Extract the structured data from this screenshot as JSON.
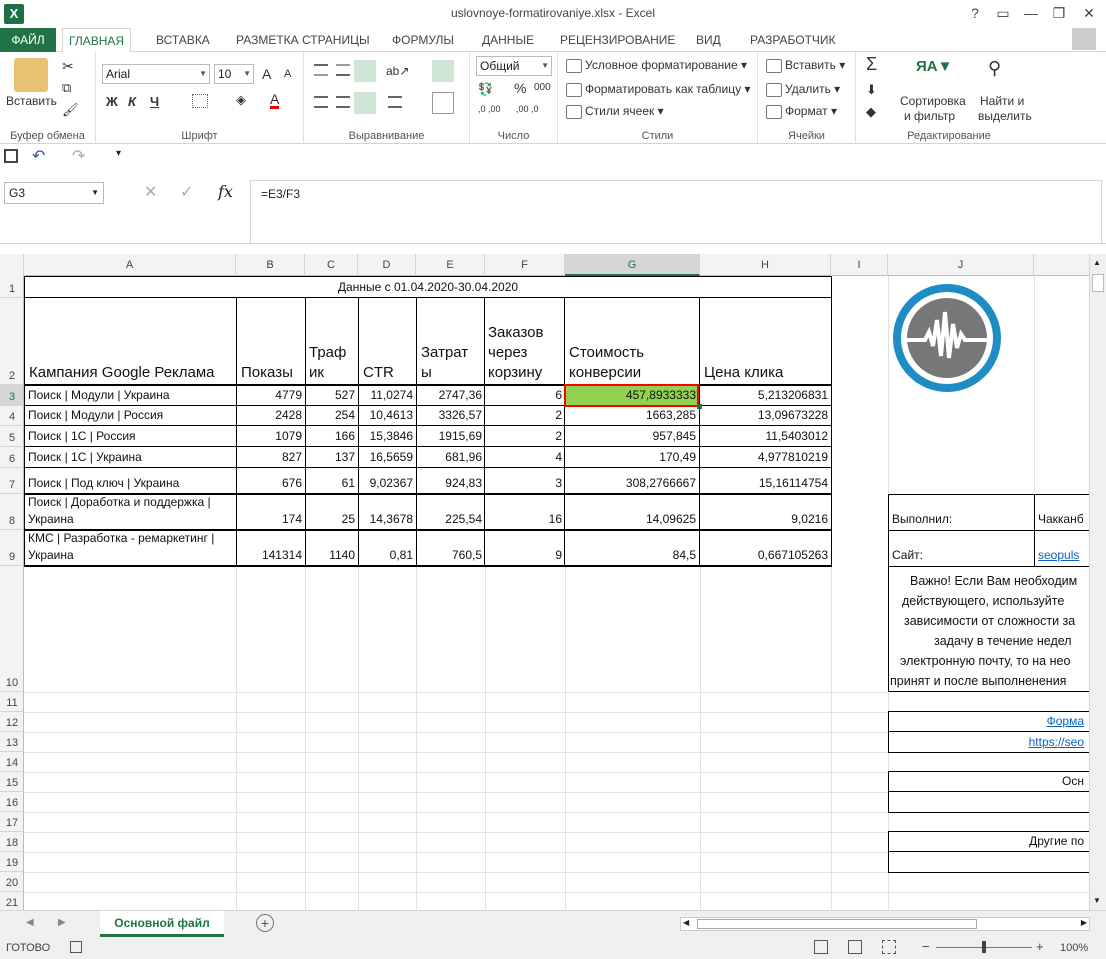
{
  "window": {
    "title": "uslovnoye-formatirovaniye.xlsx - Excel",
    "help": "?",
    "minimize": "—",
    "restore": "❐",
    "close": "✕",
    "user_name": "",
    "app_icon": "X"
  },
  "tabs": [
    "ФАЙЛ",
    "ГЛАВНАЯ",
    "ВСТАВКА",
    "РАЗМЕТКА СТРАНИЦЫ",
    "ФОРМУЛЫ",
    "ДАННЫЕ",
    "РЕЦЕНЗИРОВАНИЕ",
    "ВИД",
    "РАЗРАБОТЧИК"
  ],
  "ribbon": {
    "clipboard": {
      "paste": "Вставить",
      "label": "Буфер обмена"
    },
    "font": {
      "name": "Arial",
      "size": "10",
      "bold": "Ж",
      "italic": "К",
      "underline": "Ч",
      "grow": "A",
      "shrink": "A",
      "color_letter": "A",
      "label": "Шрифт"
    },
    "alignment": {
      "label": "Выравнивание"
    },
    "number": {
      "format": "Общий",
      "percent": "%",
      "comma": "000",
      "inc": ",0 ,00",
      "dec": ",00 ,0",
      "label": "Число"
    },
    "styles": {
      "cond": "Условное форматирование",
      "table": "Форматировать как таблицу",
      "cell": "Стили ячеек",
      "label": "Стили"
    },
    "cells": {
      "insert": "Вставить",
      "delete": "Удалить",
      "format": "Формат",
      "label": "Ячейки"
    },
    "editing": {
      "sort1": "Сортировка",
      "sort2": "и фильтр",
      "find1": "Найти и",
      "find2": "выделить",
      "label": "Редактирование"
    }
  },
  "formula_bar": {
    "name_box": "G3",
    "cancel": "✕",
    "enter": "✓",
    "fx": "fx",
    "formula": "=E3/F3"
  },
  "columns": [
    "A",
    "B",
    "C",
    "D",
    "E",
    "F",
    "G",
    "H",
    "I",
    "J"
  ],
  "rows": [
    "1",
    "2",
    "3",
    "4",
    "5",
    "6",
    "7",
    "8",
    "9",
    "10",
    "11",
    "12",
    "13",
    "14",
    "15",
    "16",
    "17",
    "18",
    "19",
    "20",
    "21"
  ],
  "sheet": {
    "header_row1": "Данные с 01.04.2020-30.04.2020",
    "headers": {
      "A": "Кампания Google Реклама",
      "B": "Показы",
      "C1": "Траф",
      "C2": "ик",
      "D": "CTR",
      "E1": "Затрат",
      "E2": "ы",
      "F1": "Заказов",
      "F2": "через",
      "F3": "корзину",
      "G1": "Стоимость",
      "G2": "конверсии",
      "H": "Цена клика"
    },
    "data": [
      {
        "A": "Поиск | Модули | Украина",
        "B": "4779",
        "C": "527",
        "D": "11,0274",
        "E": "2747,36",
        "F": "6",
        "G": "457,8933333",
        "H": "5,213206831"
      },
      {
        "A": "Поиск | Модули | Россия",
        "B": "2428",
        "C": "254",
        "D": "10,4613",
        "E": "3326,57",
        "F": "2",
        "G": "1663,285",
        "H": "13,09673228"
      },
      {
        "A": "Поиск | 1С | Россия",
        "B": "1079",
        "C": "166",
        "D": "15,3846",
        "E": "1915,69",
        "F": "2",
        "G": "957,845",
        "H": "11,5403012"
      },
      {
        "A": "Поиск | 1С | Украина",
        "B": "827",
        "C": "137",
        "D": "16,5659",
        "E": "681,96",
        "F": "4",
        "G": "170,49",
        "H": "4,977810219"
      },
      {
        "A": "Поиск | Под ключ | Украина",
        "B": "676",
        "C": "61",
        "D": "9,02367",
        "E": "924,83",
        "F": "3",
        "G": "308,2766667",
        "H": "15,16114754"
      },
      {
        "A1": "Поиск | Доработка и поддержка |",
        "A2": "Украина",
        "B": "174",
        "C": "25",
        "D": "14,3678",
        "E": "225,54",
        "F": "16",
        "G": "14,09625",
        "H": "9,0216"
      },
      {
        "A1": "КМС | Разработка - ремаркетинг |",
        "A2": "Украина",
        "B": "141314",
        "C": "1140",
        "D": "0,81",
        "E": "760,5",
        "F": "9",
        "G": "84,5",
        "H": "0,667105263"
      }
    ],
    "side": {
      "done_label": "Выполнил:",
      "done_value": "Чакканб",
      "site_label": "Сайт:",
      "site_value": "seopuls",
      "note": [
        "Важно! Если Вам необходим",
        "действующего, используйте",
        "зависимости от сложности за",
        "задачу в течение недел",
        "электронную почту, то на нео",
        "принят и после выполненения"
      ],
      "form_link": "Форма",
      "url_link": "https://seo",
      "osn": "Осн",
      "other": "Другие по"
    },
    "highlight_color": "#92d050",
    "selection_color": "#ff0000"
  },
  "sheet_tabs": {
    "active": "Основной файл",
    "add": "+"
  },
  "status": {
    "ready": "ГОТОВО",
    "zoom": "100%"
  }
}
